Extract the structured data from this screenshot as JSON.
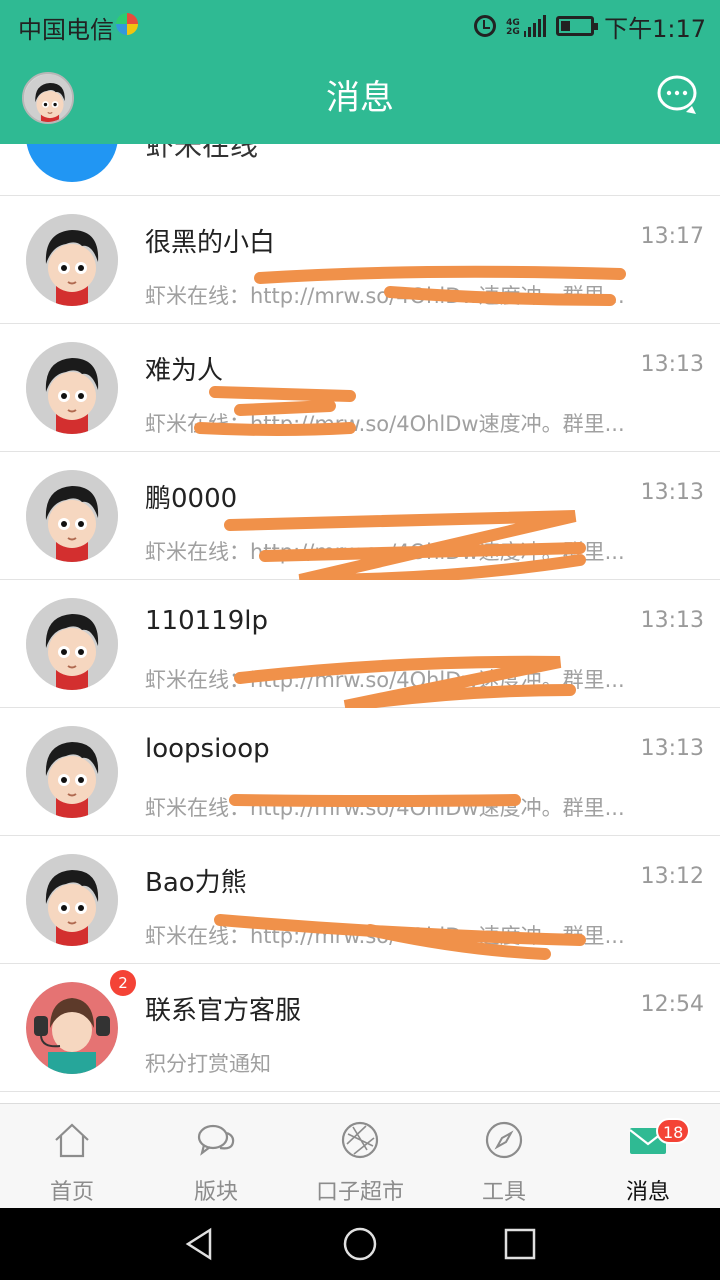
{
  "status_bar": {
    "carrier": "中国电信",
    "network_label_top": "4G",
    "network_label_bottom": "2G",
    "time": "下午1:17"
  },
  "header": {
    "title": "消息"
  },
  "partial_row": {
    "text": "虾米在线"
  },
  "messages": [
    {
      "name": "很黑的小白",
      "time": "13:17",
      "preview": "虾米在线：http://mrw.so/4OhlDw速度冲。群里..."
    },
    {
      "name": "难为人",
      "time": "13:13",
      "preview": "虾米在线：http://mrw.so/4OhlDw速度冲。群里..."
    },
    {
      "name": "鹏0000",
      "time": "13:13",
      "preview": "虾米在线：http://mrw.so/4OhlDw速度冲。群里..."
    },
    {
      "name": "110119lp",
      "time": "13:13",
      "preview": "虾米在线：http://mrw.so/4OhlDw速度冲。群里..."
    },
    {
      "name": "loopsioop",
      "time": "13:13",
      "preview": "虾米在线：http://mrw.so/4OhlDw速度冲。群里..."
    },
    {
      "name": "Bao力熊",
      "time": "13:12",
      "preview": "虾米在线：http://mrw.so/4OhlDw速度冲。群里..."
    },
    {
      "name": "联系官方客服",
      "time": "12:54",
      "preview": "积分打赏通知",
      "badge": "2"
    }
  ],
  "tabs": [
    {
      "label": "首页",
      "icon": "home-icon"
    },
    {
      "label": "版块",
      "icon": "chat-bubbles-icon"
    },
    {
      "label": "口子超市",
      "icon": "aperture-icon"
    },
    {
      "label": "工具",
      "icon": "compass-icon"
    },
    {
      "label": "消息",
      "icon": "mail-icon",
      "badge": "18",
      "active": true
    }
  ],
  "colors": {
    "brand": "#2fba93",
    "badge": "#f44336",
    "scribble": "#f0914a"
  }
}
